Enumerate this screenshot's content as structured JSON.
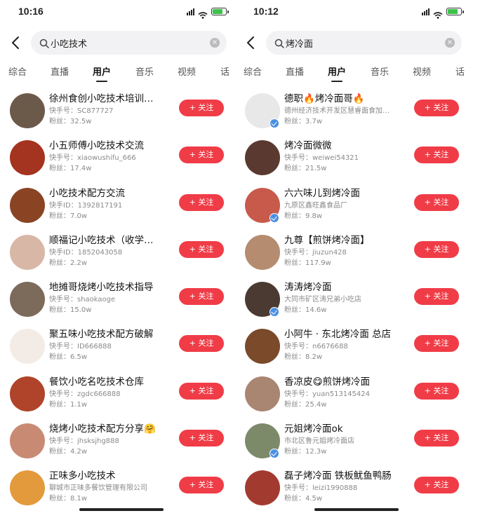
{
  "screens": [
    {
      "time": "10:16",
      "query": "小吃技术",
      "clear_glyph": "×",
      "tabs": [
        "综合",
        "直播",
        "用户",
        "音乐",
        "视频",
        "话"
      ],
      "active_tab": 2,
      "follow_label": "+ 关注",
      "users": [
        {
          "name": "徐州食创小吃技术培训…",
          "sub": "快手号：SC877727",
          "fans": "粉丝：32.5w",
          "avatar_color": "#6b5a4a",
          "verified": false
        },
        {
          "name": "小五师傅小吃技术交流",
          "sub": "快手号：xiaowushifu_666",
          "fans": "粉丝：17.4w",
          "avatar_color": "#a4331f",
          "verified": false
        },
        {
          "name": "小吃技术配方交流",
          "sub": "快手ID：1392817191",
          "fans": "粉丝：7.0w",
          "avatar_color": "#8a4424",
          "verified": false
        },
        {
          "name": "顺福记小吃技术（收学…",
          "sub": "快手ID：1852043058",
          "fans": "粉丝：2.2w",
          "avatar_color": "#d9b7a6",
          "verified": false
        },
        {
          "name": "地摊哥烧烤小吃技术指导",
          "sub": "快手号：shaokaoge",
          "fans": "粉丝：15.0w",
          "avatar_color": "#7c6a5b",
          "verified": false
        },
        {
          "name": "聚五味小吃技术配方破解",
          "sub": "快手号：ID666888",
          "fans": "粉丝：6.5w",
          "avatar_color": "#f3ece6",
          "verified": false
        },
        {
          "name": "餐饮小吃名吃技术仓库",
          "sub": "快手号：zgdc666888",
          "fans": "粉丝：1.1w",
          "avatar_color": "#b0442a",
          "verified": false
        },
        {
          "name": "烧烤小吃技术配方分享🤗",
          "sub": "快手号：jhsksjhg888",
          "fans": "粉丝：4.2w",
          "avatar_color": "#c98a74",
          "verified": false
        },
        {
          "name": "正味多小吃技术",
          "sub": "聊城市正味多餐饮管理有限公司",
          "fans": "粉丝：8.1w",
          "avatar_color": "#e39a3c",
          "verified": false
        }
      ]
    },
    {
      "time": "10:12",
      "query": "烤冷面",
      "clear_glyph": "×",
      "tabs": [
        "综合",
        "直播",
        "用户",
        "音乐",
        "视频",
        "话"
      ],
      "active_tab": 2,
      "follow_label": "+ 关注",
      "users": [
        {
          "name": "德职🔥烤冷面哥🔥",
          "sub": "德州经济技术开发区慧睿面食加…",
          "fans": "粉丝：3.7w",
          "avatar_color": "#e8e8e8",
          "verified": true
        },
        {
          "name": "烤冷面微微",
          "sub": "快手号：weiwei54321",
          "fans": "粉丝：21.5w",
          "avatar_color": "#5a3a30",
          "verified": false
        },
        {
          "name": "六六味儿到烤冷面",
          "sub": "九原区鑫旺鑫食品厂",
          "fans": "粉丝：9.8w",
          "avatar_color": "#c85a4c",
          "verified": true
        },
        {
          "name": "九尊【煎饼烤冷面】",
          "sub": "快手号：jiuzun428",
          "fans": "粉丝：117.9w",
          "avatar_color": "#b58c70",
          "verified": false
        },
        {
          "name": "涛涛烤冷面",
          "sub": "大同市矿区涛兄弟小吃店",
          "fans": "粉丝：14.6w",
          "avatar_color": "#4a3a32",
          "verified": true
        },
        {
          "name": "小阿牛 · 东北烤冷面 总店",
          "sub": "快手号：n6676688",
          "fans": "粉丝：8.2w",
          "avatar_color": "#7a4a2a",
          "verified": false
        },
        {
          "name": "香凉皮😋煎饼烤冷面",
          "sub": "快手号：yuan513145424",
          "fans": "粉丝：25.4w",
          "avatar_color": "#a88672",
          "verified": false
        },
        {
          "name": "元姐烤冷面ok",
          "sub": "市北区鲁元姐烤冷面店",
          "fans": "粉丝：12.3w",
          "avatar_color": "#7d8a6a",
          "verified": true
        },
        {
          "name": "磊子烤冷面 铁板鱿鱼鸭肠",
          "sub": "快手号：leizi1990888",
          "fans": "粉丝：4.5w",
          "avatar_color": "#a33a30",
          "verified": false
        }
      ]
    }
  ]
}
